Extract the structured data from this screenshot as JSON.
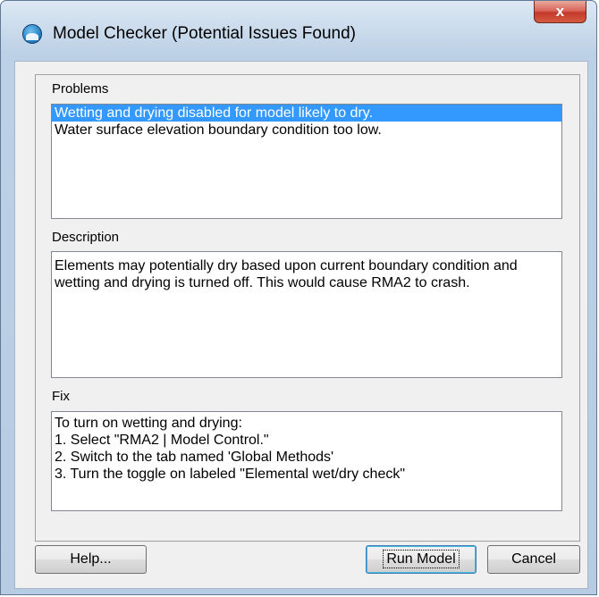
{
  "window": {
    "title": "Model Checker (Potential Issues Found)",
    "close_glyph": "x",
    "icon": "sms-water-icon"
  },
  "problems": {
    "label": "Problems",
    "items": [
      {
        "text": "Wetting and drying disabled for model likely to dry.",
        "selected": true
      },
      {
        "text": "Water surface elevation boundary condition too low.",
        "selected": false
      }
    ]
  },
  "description": {
    "label": "Description",
    "lines": [
      "Elements may potentially dry based upon current boundary condition and",
      "wetting and drying is turned off.  This would cause RMA2 to crash."
    ]
  },
  "fix": {
    "label": "Fix",
    "lines": [
      "To turn on wetting and drying:",
      "1. Select \"RMA2 | Model Control.\"",
      "2. Switch to the tab named 'Global Methods'",
      "3. Turn the toggle on labeled \"Elemental wet/dry check\""
    ]
  },
  "buttons": {
    "help": "Help...",
    "run_model": "Run Model",
    "cancel": "Cancel"
  },
  "colors": {
    "selection": "#3399ff",
    "close_button": "#c33a2c"
  }
}
